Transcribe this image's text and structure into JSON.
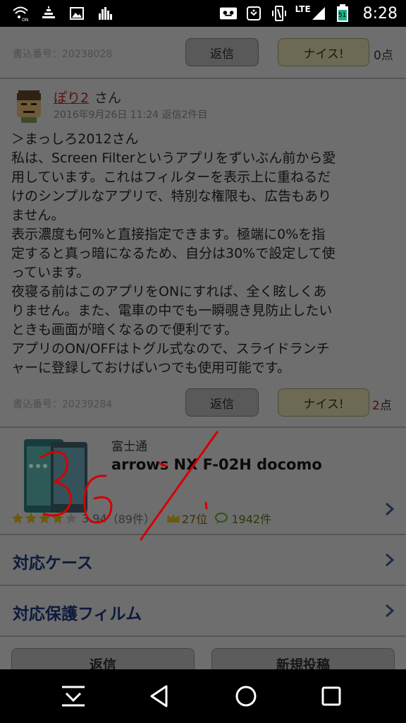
{
  "status_bar": {
    "icons_left": [
      "wifi-on-icon",
      "signal-meter-icon",
      "image-icon",
      "equalizer-icon"
    ],
    "icons_right": [
      "voicemail-icon",
      "alarm-icon",
      "vibrate-icon",
      "lte-signal-icon",
      "battery-icon"
    ],
    "network": "LTE",
    "battery_level": "51",
    "time": "8:28"
  },
  "prev_post": {
    "post_number": "書込番号：20238028",
    "reply_label": "返信",
    "nice_label": "ナイス!",
    "score_num": "0",
    "score_unit": "点"
  },
  "post": {
    "username": "ぽり2",
    "username_suffix": "さん",
    "date": "2016年9月26日 11:24 返信2件目",
    "body_lines": [
      "＞まっしろ2012さん",
      "私は、Screen Filterというアプリをずいぶん前から愛",
      "用しています。これはフィルターを表示上に重ねるだ",
      "けのシンプルなアプリで、特別な権限も、広告もあり",
      "ません。",
      "表示濃度も何%と直接指定できます。極端に0%を指",
      "定すると真っ暗になるため、自分は30%で設定して使",
      "っています。",
      "夜寝る前はこのアプリをONにすれば、全く眩しくあ",
      "りません。また、電車の中でも一瞬覗き見防止したい",
      "ときも画面が暗くなるので便利です。",
      "アプリのON/OFFはトグル式なので、スライドランチ",
      "ャーに登録しておけばいつでも使用可能です。"
    ],
    "post_number": "書込番号：20239284",
    "reply_label": "返信",
    "nice_label": "ナイス!",
    "score_num": "2",
    "score_unit": "点"
  },
  "product": {
    "maker": "富士通",
    "model": "arrows NX F-02H docomo",
    "rating": "3.94",
    "rating_count": "（89件）",
    "rank": "27位",
    "review_count": "1942件",
    "stars_filled": 3.94
  },
  "links": {
    "cases": "対応ケース",
    "films": "対応保護フィルム"
  },
  "bottom_actions": {
    "reply": "返信",
    "new_post": "新規投稿"
  },
  "colors": {
    "dim_overlay": "#6e6e6e",
    "scribble": "#d40000",
    "link_navy": "#0d1a3c"
  }
}
